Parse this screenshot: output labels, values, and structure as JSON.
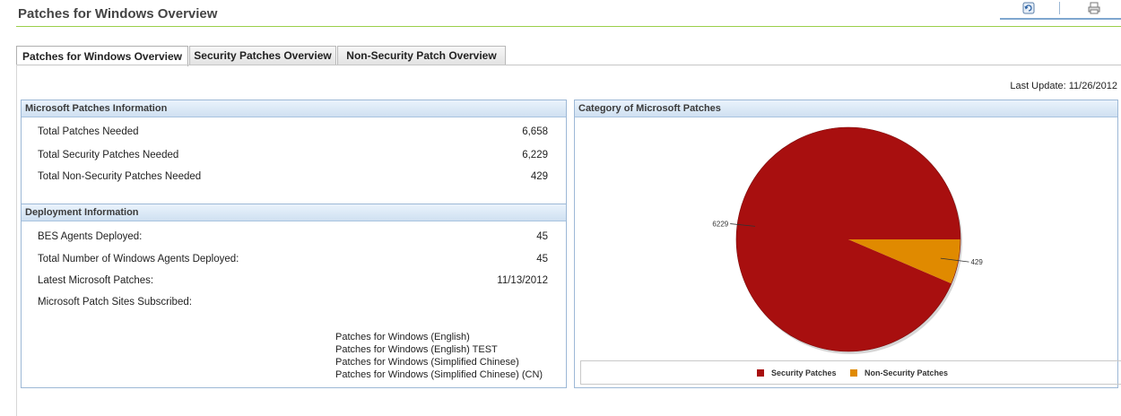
{
  "page": {
    "title": "Patches for Windows Overview",
    "last_update": "Last Update: 11/26/2012"
  },
  "toolbar": {
    "refresh_icon": "refresh-icon",
    "print_icon": "print-icon"
  },
  "tabs": [
    {
      "label": "Patches for Windows Overview",
      "active": true
    },
    {
      "label": "Security Patches Overview",
      "active": false
    },
    {
      "label": "Non-Security Patch Overview",
      "active": false
    }
  ],
  "patches_info": {
    "header": "Microsoft Patches Information",
    "rows": [
      {
        "label": "Total Patches Needed",
        "value": "6,658"
      },
      {
        "label": "Total Security Patches Needed",
        "value": "6,229"
      },
      {
        "label": "Total Non-Security Patches Needed",
        "value": "429"
      }
    ]
  },
  "deployment_info": {
    "header": "Deployment Information",
    "rows": [
      {
        "label": "BES Agents Deployed:",
        "value": "45"
      },
      {
        "label": "Total Number of Windows Agents Deployed:",
        "value": "45"
      },
      {
        "label": "Latest Microsoft Patches:",
        "value": "11/13/2012"
      },
      {
        "label": "Microsoft Patch Sites Subscribed:",
        "value": ""
      }
    ],
    "sites": [
      "Patches for Windows (English)",
      "Patches for Windows (English) TEST",
      "Patches for Windows (Simplified Chinese)",
      "Patches for Windows (Simplified Chinese) (CN)"
    ]
  },
  "category_panel": {
    "header": "Category of Microsoft Patches"
  },
  "colors": {
    "security": "#a80f0f",
    "non_security": "#e08a00"
  },
  "chart_data": {
    "type": "pie",
    "title": "",
    "slices": [
      {
        "name": "Security Patches",
        "value": 6229,
        "label": "6229"
      },
      {
        "name": "Non-Security Patches",
        "value": 429,
        "label": "429"
      }
    ],
    "legend": "bottom"
  }
}
